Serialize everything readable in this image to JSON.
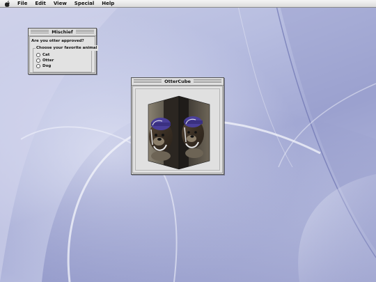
{
  "menubar": {
    "apple_icon": "apple-logo-icon",
    "items": [
      "File",
      "Edit",
      "View",
      "Special",
      "Help"
    ]
  },
  "mischief_window": {
    "title": "Mischief",
    "question": "Are you otter approved?",
    "group_label": "Choose your favorite animal",
    "options": [
      {
        "label": "Cat",
        "selected": false
      },
      {
        "label": "Otter",
        "selected": false
      },
      {
        "label": "Dog",
        "selected": false
      }
    ]
  },
  "ottercube_window": {
    "title": "OtterCube",
    "cube_faces": [
      "otter-photo",
      "otter-photo"
    ]
  },
  "colors": {
    "desktop": "#b7bde0",
    "window_face": "#dedede",
    "otter_hat": "#4a3f9a"
  }
}
